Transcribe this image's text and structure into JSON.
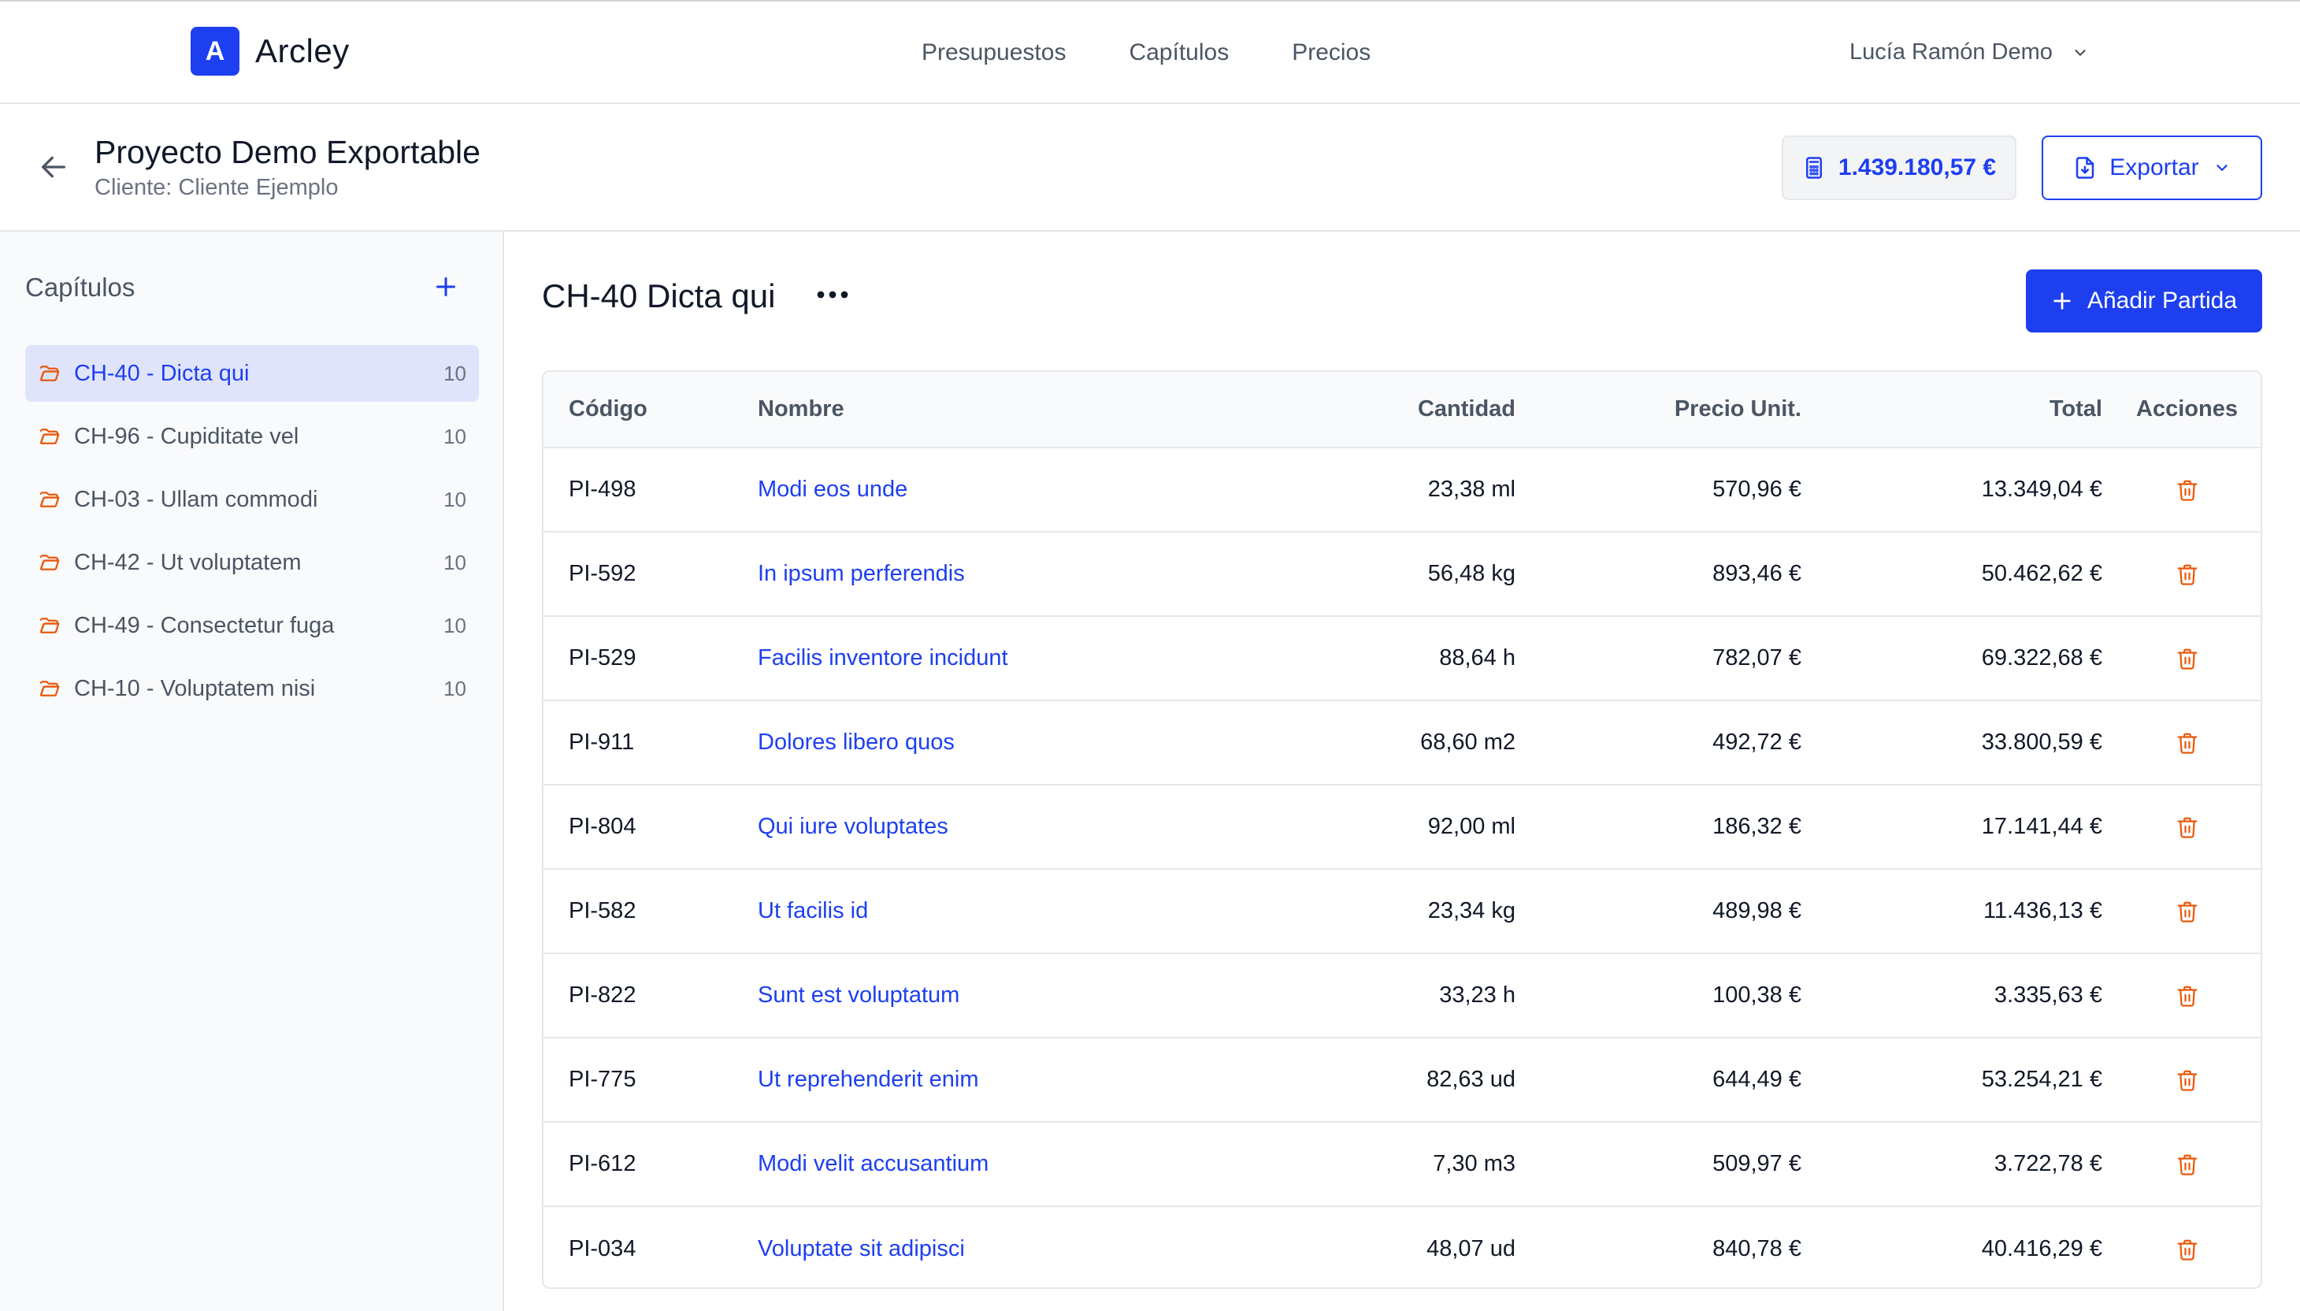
{
  "brand": {
    "logo_letter": "A",
    "name": "Arcley",
    "accent": "#1d3ff0"
  },
  "nav": {
    "links": [
      "Presupuestos",
      "Capítulos",
      "Precios"
    ],
    "user": "Lucía Ramón Demo"
  },
  "project": {
    "title": "Proyecto Demo Exportable",
    "client": "Cliente: Cliente Ejemplo",
    "total": "1.439.180,57 €",
    "export_label": "Exportar"
  },
  "sidebar": {
    "heading": "Capítulos",
    "chapters": [
      {
        "label": "CH-40 - Dicta qui",
        "count": "10",
        "active": true
      },
      {
        "label": "CH-96 - Cupiditate vel",
        "count": "10",
        "active": false
      },
      {
        "label": "CH-03 - Ullam commodi",
        "count": "10",
        "active": false
      },
      {
        "label": "CH-42 - Ut voluptatem",
        "count": "10",
        "active": false
      },
      {
        "label": "CH-49 - Consectetur fuga",
        "count": "10",
        "active": false
      },
      {
        "label": "CH-10 - Voluptatem nisi",
        "count": "10",
        "active": false
      }
    ]
  },
  "main": {
    "chapter_title": "CH-40 Dicta qui",
    "add_label": "Añadir Partida",
    "columns": [
      "Código",
      "Nombre",
      "Cantidad",
      "Precio Unit.",
      "Total",
      "Acciones"
    ],
    "rows": [
      {
        "code": "PI-498",
        "name": "Modi eos unde",
        "qty": "23,38 ml",
        "price": "570,96 €",
        "total": "13.349,04 €"
      },
      {
        "code": "PI-592",
        "name": "In ipsum perferendis",
        "qty": "56,48 kg",
        "price": "893,46 €",
        "total": "50.462,62 €"
      },
      {
        "code": "PI-529",
        "name": "Facilis inventore incidunt",
        "qty": "88,64 h",
        "price": "782,07 €",
        "total": "69.322,68 €"
      },
      {
        "code": "PI-911",
        "name": "Dolores libero quos",
        "qty": "68,60 m2",
        "price": "492,72 €",
        "total": "33.800,59 €"
      },
      {
        "code": "PI-804",
        "name": "Qui iure voluptates",
        "qty": "92,00 ml",
        "price": "186,32 €",
        "total": "17.141,44 €"
      },
      {
        "code": "PI-582",
        "name": "Ut facilis id",
        "qty": "23,34 kg",
        "price": "489,98 €",
        "total": "11.436,13 €"
      },
      {
        "code": "PI-822",
        "name": "Sunt est voluptatum",
        "qty": "33,23 h",
        "price": "100,38 €",
        "total": "3.335,63 €"
      },
      {
        "code": "PI-775",
        "name": "Ut reprehenderit enim",
        "qty": "82,63 ud",
        "price": "644,49 €",
        "total": "53.254,21 €"
      },
      {
        "code": "PI-612",
        "name": "Modi velit accusantium",
        "qty": "7,30 m3",
        "price": "509,97 €",
        "total": "3.722,78 €"
      },
      {
        "code": "PI-034",
        "name": "Voluptate sit adipisci",
        "qty": "48,07 ud",
        "price": "840,78 €",
        "total": "40.416,29 €"
      }
    ]
  }
}
